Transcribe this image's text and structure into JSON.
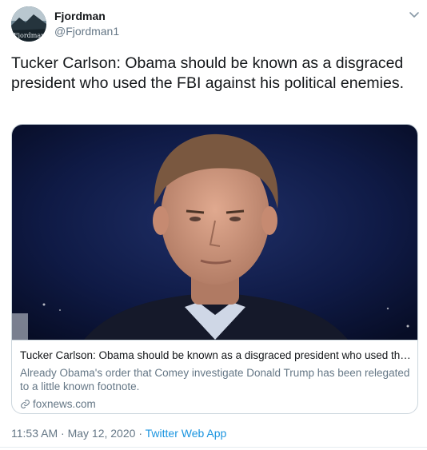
{
  "tweet": {
    "author_name": "Fjordman",
    "author_handle": "@Fjordman1",
    "avatar_text": "Fjordman",
    "text": "Tucker Carlson: Obama should be known as a disgraced president who used the FBI against his political enemies.",
    "card": {
      "title": "Tucker Carlson: Obama should be known as a disgraced president who used the ...",
      "description": "Already Obama's order that Comey investigate Donald Trump has been relegated to a little known footnote.",
      "domain": "foxnews.com"
    },
    "time": "11:53 AM",
    "separator1": "·",
    "date": "May 12, 2020",
    "separator2": "·",
    "source": "Twitter Web App"
  },
  "colors": {
    "link": "#1b95e0",
    "secondary_text": "#657786",
    "border": "#ccd6dd"
  },
  "icons": {
    "caret": "chevron-down-icon",
    "card_link": "link-icon"
  }
}
